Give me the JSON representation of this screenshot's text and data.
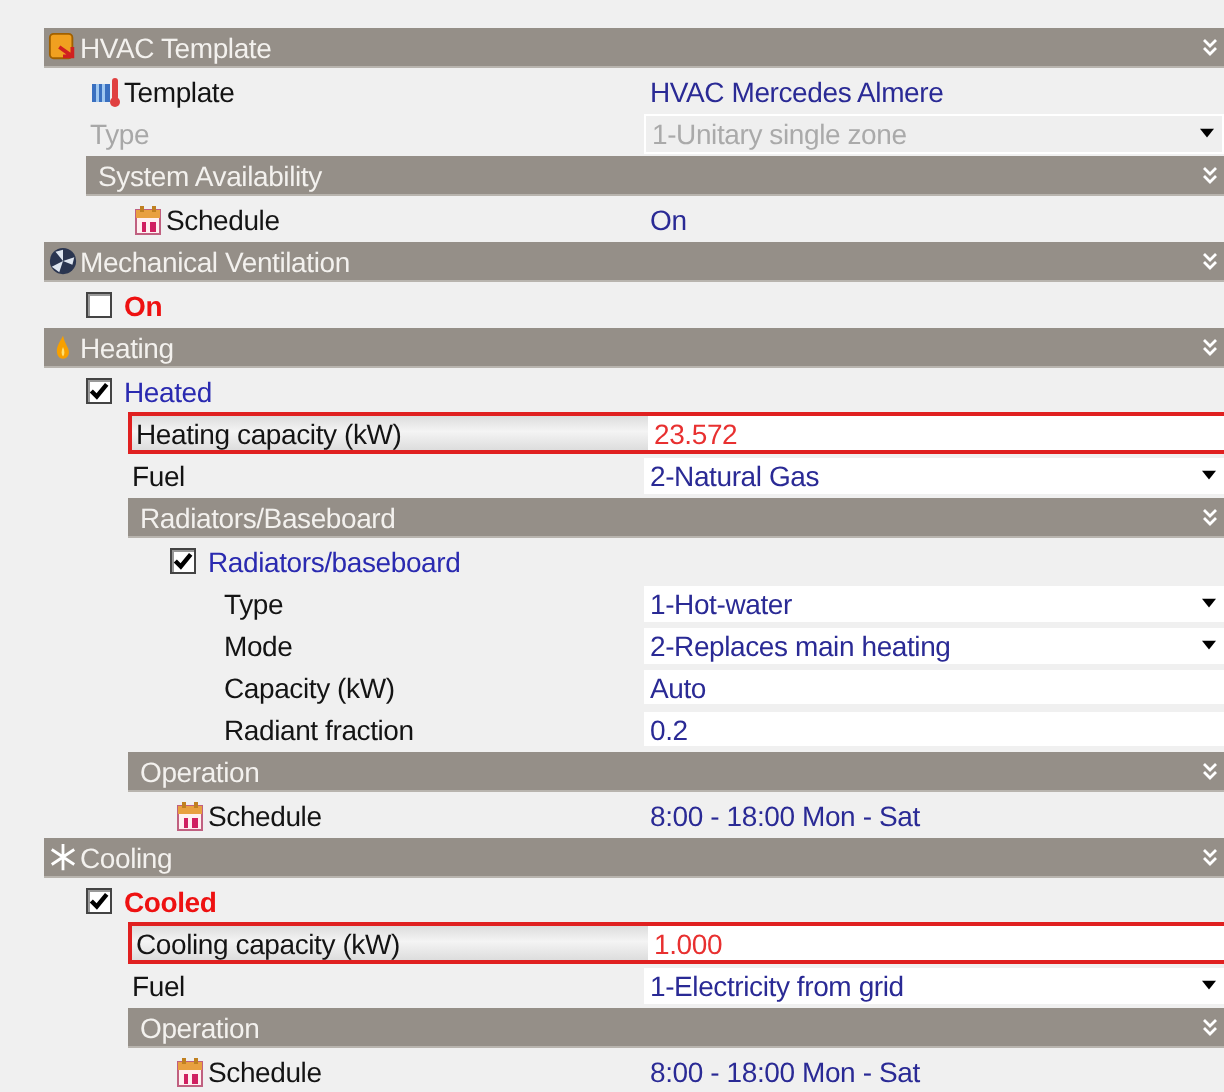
{
  "sections": [
    {
      "title": "HVAC Template",
      "items": [
        {
          "kind": "template",
          "label": "Template",
          "value": "HVAC Mercedes Almere",
          "disabled": false,
          "highlighted": false
        },
        {
          "kind": "dropdown",
          "label": "Type",
          "value": "1-Unitary single zone",
          "disabled": true,
          "highlighted": false
        },
        {
          "kind": "group",
          "title": "System Availability",
          "items": [
            {
              "kind": "schedule",
              "label": "Schedule",
              "value": "On",
              "disabled": false,
              "highlighted": false
            }
          ]
        }
      ]
    },
    {
      "title": "Mechanical Ventilation",
      "items": [
        {
          "kind": "check",
          "label": "On",
          "checked": false,
          "alert": true
        }
      ]
    },
    {
      "title": "Heating",
      "items": [
        {
          "kind": "check",
          "label": "Heated",
          "checked": true,
          "alert": false,
          "items": [
            {
              "kind": "input",
              "label": "Heating capacity (kW)",
              "value": "23.572",
              "disabled": false,
              "highlighted": true
            },
            {
              "kind": "dropdown",
              "label": "Fuel",
              "value": "2-Natural Gas",
              "disabled": false,
              "highlighted": false
            },
            {
              "kind": "group",
              "title": "Radiators/Baseboard",
              "items": [
                {
                  "kind": "check",
                  "label": "Radiators/baseboard",
                  "checked": true,
                  "alert": false,
                  "items": [
                    {
                      "kind": "dropdown",
                      "label": "Type",
                      "value": "1-Hot-water",
                      "disabled": false,
                      "highlighted": false
                    },
                    {
                      "kind": "dropdown",
                      "label": "Mode",
                      "value": "2-Replaces main heating",
                      "disabled": false,
                      "highlighted": false
                    },
                    {
                      "kind": "input",
                      "label": "Capacity (kW)",
                      "value": "Auto",
                      "disabled": false,
                      "highlighted": false
                    },
                    {
                      "kind": "input",
                      "label": "Radiant fraction",
                      "value": "0.2",
                      "disabled": false,
                      "highlighted": false
                    }
                  ]
                }
              ]
            },
            {
              "kind": "group",
              "title": "Operation",
              "items": [
                {
                  "kind": "schedule",
                  "label": "Schedule",
                  "value": "8:00 - 18:00 Mon - Sat",
                  "disabled": false,
                  "highlighted": false
                }
              ]
            }
          ]
        }
      ]
    },
    {
      "title": "Cooling",
      "items": [
        {
          "kind": "check",
          "label": "Cooled",
          "checked": true,
          "alert": true,
          "items": [
            {
              "kind": "input",
              "label": "Cooling capacity (kW)",
              "value": "1.000",
              "disabled": false,
              "highlighted": true
            },
            {
              "kind": "dropdown",
              "label": "Fuel",
              "value": "1-Electricity from grid",
              "disabled": false,
              "highlighted": false
            },
            {
              "kind": "group",
              "title": "Operation",
              "items": [
                {
                  "kind": "schedule",
                  "label": "Schedule",
                  "value": "8:00 - 18:00 Mon - Sat",
                  "disabled": false,
                  "highlighted": false
                }
              ]
            }
          ]
        }
      ]
    }
  ]
}
